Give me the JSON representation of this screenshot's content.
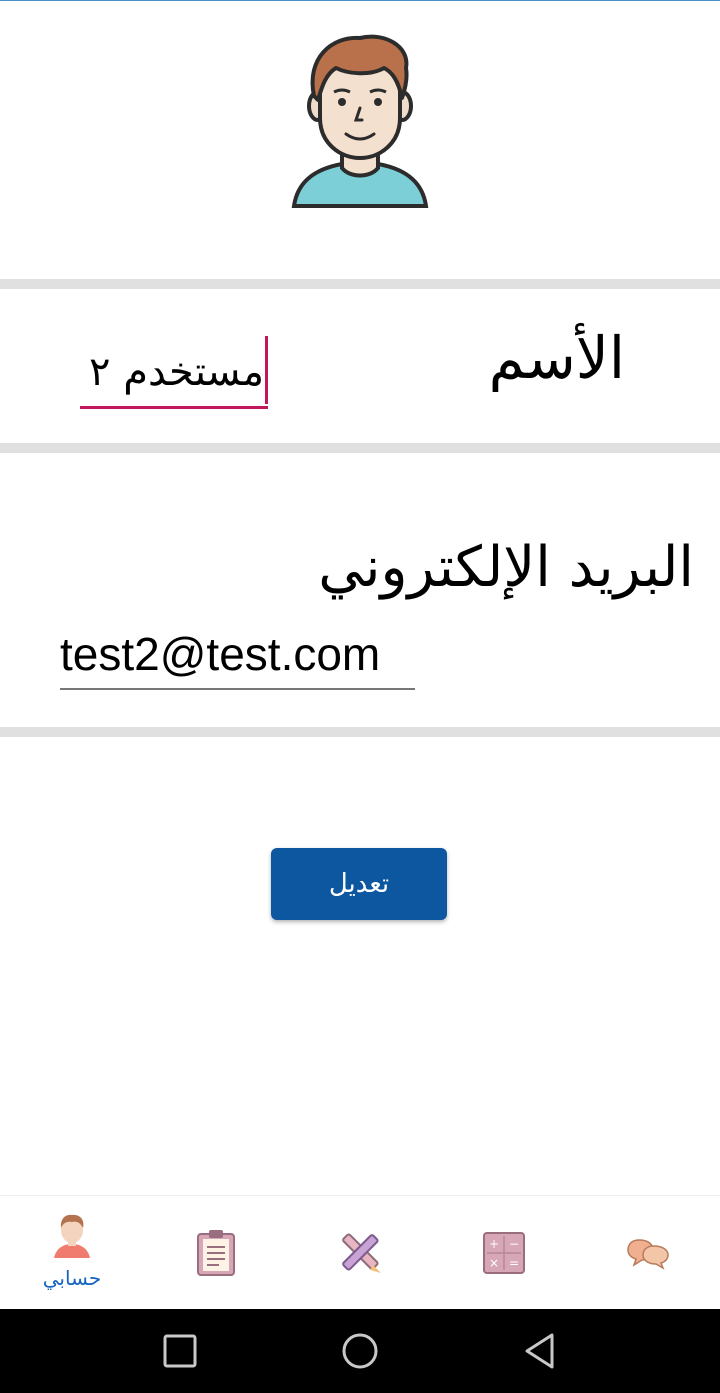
{
  "profile": {
    "name_label": "الأسم",
    "name_value": "مستخدم ٢",
    "email_label": "البريد الإلكتروني",
    "email_value": "test2@test.com",
    "edit_button": "تعديل"
  },
  "bottom_nav": {
    "items": [
      {
        "icon": "account-icon",
        "label": "حسابي",
        "active": true
      },
      {
        "icon": "clipboard-icon"
      },
      {
        "icon": "pencil-ruler-icon"
      },
      {
        "icon": "calculator-icon"
      },
      {
        "icon": "chat-bubbles-icon"
      }
    ]
  },
  "colors": {
    "accent": "#c2185b",
    "button": "#0d57a1",
    "nav_active": "#1565c0",
    "divider": "#e0e0e0"
  }
}
